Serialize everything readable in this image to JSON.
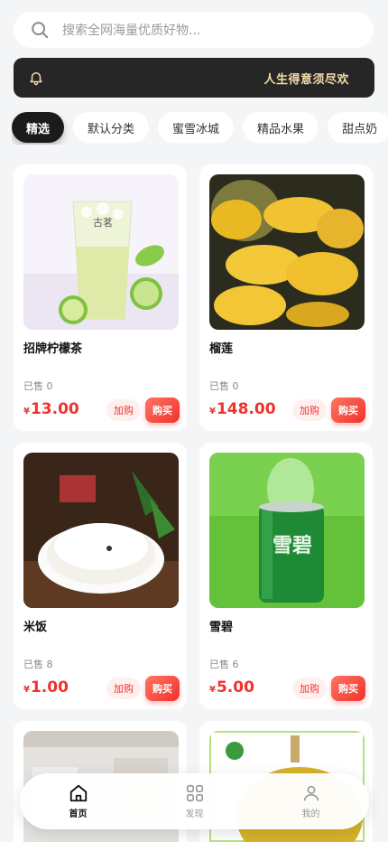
{
  "search": {
    "placeholder": "搜索全网海量优质好物..."
  },
  "notice": {
    "text": "人生得意须尽欢"
  },
  "categories": [
    "精选",
    "默认分类",
    "蜜雪冰城",
    "精品水果",
    "甜点奶"
  ],
  "products": [
    {
      "name": "招牌柠檬茶",
      "sold": "已售 0",
      "currency": "¥",
      "price": "13.00",
      "add": "加购",
      "buy": "购买",
      "image": "lemon-tea-image",
      "image_text": "古茗"
    },
    {
      "name": "榴莲",
      "sold": "已售 0",
      "currency": "¥",
      "price": "148.00",
      "add": "加购",
      "buy": "购买",
      "image": "durian-image"
    },
    {
      "name": "米饭",
      "sold": "已售 8",
      "currency": "¥",
      "price": "1.00",
      "add": "加购",
      "buy": "购买",
      "image": "rice-image"
    },
    {
      "name": "雪碧",
      "sold": "已售 6",
      "currency": "¥",
      "price": "5.00",
      "add": "加购",
      "buy": "购买",
      "image": "sprite-can-image",
      "image_text": "雪碧"
    },
    {
      "name": "",
      "image": "room-image"
    },
    {
      "name": "",
      "image": "durian-fruit-image"
    }
  ],
  "nav": [
    {
      "label": "首页",
      "icon": "home-icon",
      "active": true
    },
    {
      "label": "发现",
      "icon": "grid-icon",
      "active": false
    },
    {
      "label": "我的",
      "icon": "user-icon",
      "active": false
    }
  ],
  "colors": {
    "accent": "#f0322d",
    "notice_bg": "#262626",
    "notice_text": "#f3d9a9"
  }
}
